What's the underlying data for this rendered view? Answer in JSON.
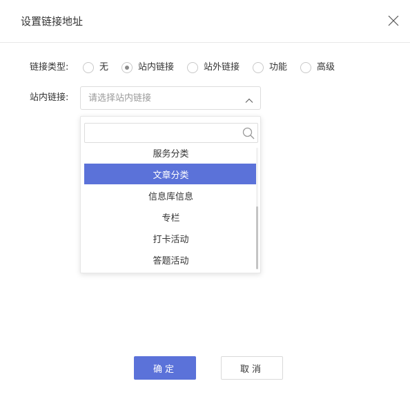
{
  "dialog": {
    "title": "设置链接地址"
  },
  "form": {
    "link_type_label": "链接类型:",
    "link_type_options": [
      {
        "label": "无",
        "checked": false
      },
      {
        "label": "站内链接",
        "checked": true
      },
      {
        "label": "站外链接",
        "checked": false
      },
      {
        "label": "功能",
        "checked": false
      },
      {
        "label": "高级",
        "checked": false
      }
    ],
    "internal_link_label": "站内链接:",
    "internal_link_placeholder": "请选择站内链接"
  },
  "dropdown": {
    "search_value": "",
    "options": [
      {
        "label": "服务分类",
        "active": false
      },
      {
        "label": "文章分类",
        "active": true
      },
      {
        "label": "信息库信息",
        "active": false
      },
      {
        "label": "专栏",
        "active": false
      },
      {
        "label": "打卡活动",
        "active": false
      },
      {
        "label": "答题活动",
        "active": false
      }
    ]
  },
  "footer": {
    "ok_label": "确定",
    "cancel_label": "取消"
  },
  "colors": {
    "accent": "#5b72d9",
    "border": "#dcdcdc"
  },
  "icons": {
    "close": "close-icon",
    "radio": "radio-icon",
    "select_arrow": "chevron-up-icon",
    "search": "search-icon"
  }
}
